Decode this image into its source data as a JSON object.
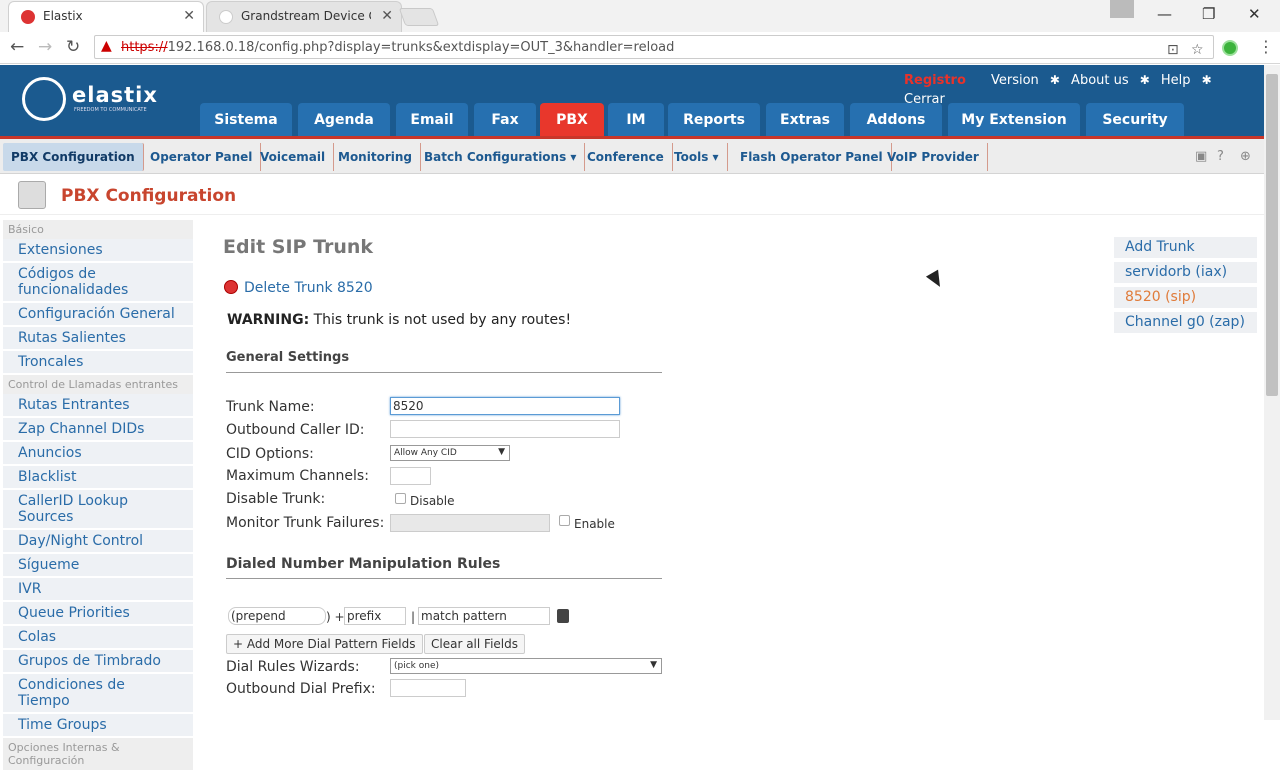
{
  "browser": {
    "tabs": [
      {
        "title": "Elastix",
        "active": true
      },
      {
        "title": "Grandstream Device Con",
        "active": false
      }
    ],
    "window_controls": {
      "minimize": "—",
      "restore": "❐",
      "close": "✕"
    },
    "url_protocol": "https://",
    "url_rest": "192.168.0.18/config.php?display=trunks&extdisplay=OUT_3&handler=reload"
  },
  "banner": {
    "logo_text": "elastix",
    "logo_sub": "FREEDOM TO COMMUNICATE",
    "top_links": [
      "Registro",
      "Version",
      "About us",
      "Help",
      "Cerrar"
    ],
    "main_tabs": [
      "Sistema",
      "Agenda",
      "Email",
      "Fax",
      "PBX",
      "IM",
      "Reports",
      "Extras",
      "Addons",
      "My Extension",
      "Security"
    ],
    "active_tab": "PBX"
  },
  "subnav": {
    "items": [
      "PBX Configuration",
      "Operator Panel",
      "Voicemail",
      "Monitoring",
      "Batch Configurations ▾",
      "Conference",
      "Tools ▾",
      "Flash Operator Panel",
      "VoIP Provider"
    ]
  },
  "page": {
    "title": "PBX Configuration"
  },
  "sidebar": {
    "section_basic": "Básico",
    "basic_items": [
      "Extensiones",
      "Códigos de funcionalidades",
      "Configuración General",
      "Rutas Salientes",
      "Troncales"
    ],
    "section_inbound": "Control de Llamadas entrantes",
    "inbound_items": [
      "Rutas Entrantes",
      "Zap Channel DIDs",
      "Anuncios",
      "Blacklist",
      "CallerID Lookup Sources",
      "Day/Night Control",
      "Sígueme",
      "IVR",
      "Queue Priorities",
      "Colas",
      "Grupos de Timbrado",
      "Condiciones de Tiempo",
      "Time Groups"
    ],
    "section_internal": "Opciones Internas & Configuración"
  },
  "form": {
    "heading": "Edit SIP Trunk",
    "delete_label": "Delete Trunk 8520",
    "warning_bold": "WARNING:",
    "warning_text": " This trunk is not used by any routes!",
    "general_settings": "General Settings",
    "trunk_name_label": "Trunk Name:",
    "trunk_name_value": "8520",
    "outbound_cid_label": "Outbound Caller ID:",
    "cid_options_label": "CID Options:",
    "cid_options_value": "Allow Any CID",
    "max_channels_label": "Maximum Channels:",
    "disable_trunk_label": "Disable Trunk:",
    "disable_checkbox_label": "Disable",
    "monitor_label": "Monitor Trunk Failures:",
    "enable_checkbox_label": "Enable",
    "dial_rules_title": "Dialed Number Manipulation Rules",
    "prepend_placeholder": "(prepend",
    "plus": ")  +",
    "prefix_placeholder": "prefix",
    "pipe": "|",
    "match_placeholder": "match pattern",
    "add_more_button": "+ Add More Dial Pattern Fields",
    "clear_all_button": "Clear all Fields",
    "dial_wizards_label": "Dial Rules Wizards:",
    "dial_wizards_value": "(pick one)",
    "outbound_prefix_label": "Outbound Dial Prefix:"
  },
  "right_panel": {
    "items": [
      "Add Trunk",
      "servidorb (iax)",
      "8520 (sip)",
      "Channel g0 (zap)"
    ],
    "current": "8520 (sip)"
  },
  "colors": {
    "banner_blue": "#1b5a8f",
    "active_tab_red": "#e8372c",
    "link_blue": "#2a6ca8",
    "title_orange": "#c8452e"
  }
}
